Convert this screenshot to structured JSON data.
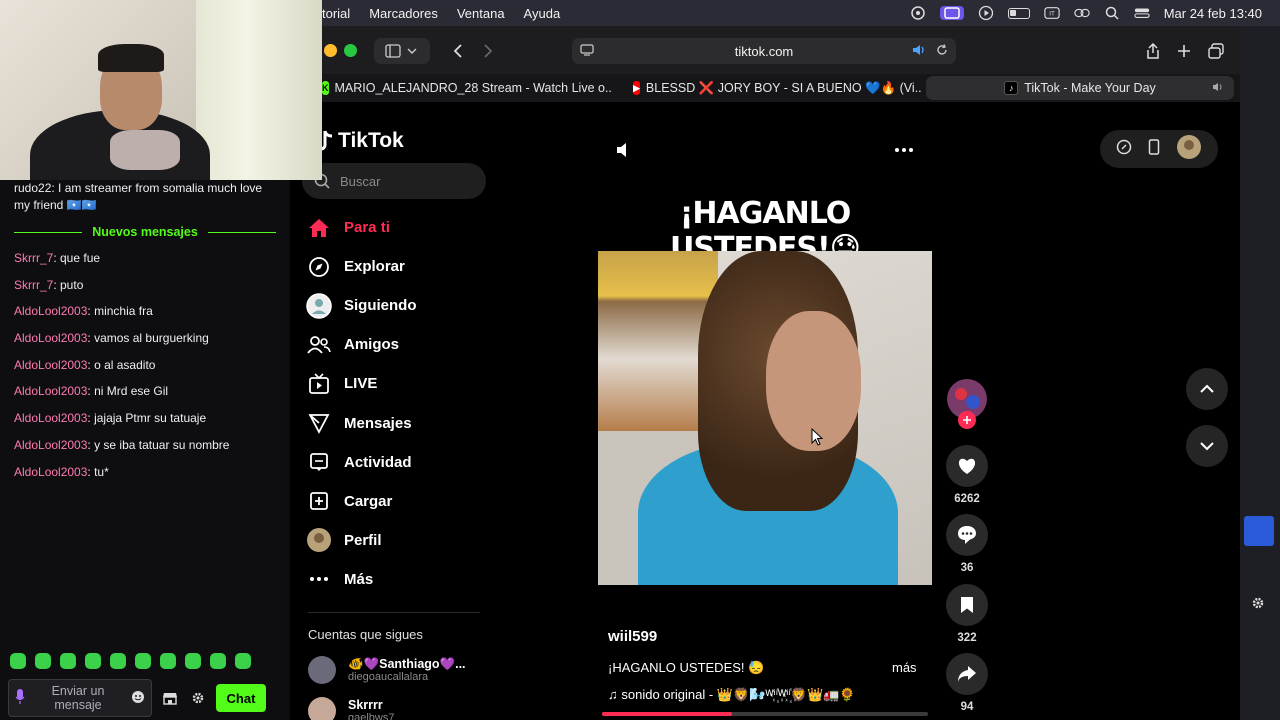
{
  "menubar": {
    "menus": [
      "torial",
      "Marcadores",
      "Ventana",
      "Ayuda"
    ],
    "datetime": "Mar 24 feb 13:40",
    "icons": [
      "copilot-icon",
      "screen-mirroring-icon",
      "play-icon",
      "battery-icon",
      "input-source-icon",
      "link-icon",
      "search-icon",
      "control-center-icon"
    ]
  },
  "chat": {
    "first_message": "rudo22: I am streamer from somalia much love my friend 🇸🇴🇸🇴",
    "new_messages_label": "Nuevos mensajes",
    "messages": [
      {
        "user": "Skrrr_7",
        "text": ": que fue"
      },
      {
        "user": "Skrrr_7",
        "text": ": puto"
      },
      {
        "user": "AldoLool2003",
        "text": ": minchia fra"
      },
      {
        "user": "AldoLool2003",
        "text": ": vamos al burguerking"
      },
      {
        "user": "AldoLool2003",
        "text": ": o al asadito"
      },
      {
        "user": "AldoLool2003",
        "text": ": ni Mrd ese Gil"
      },
      {
        "user": "AldoLool2003",
        "text": ": jajaja Ptmr su tatuaje"
      },
      {
        "user": "AldoLool2003",
        "text": ": y se iba tatuar su nombre"
      },
      {
        "user": "AldoLool2003",
        "text": ": tu*"
      }
    ],
    "input_placeholder": "Enviar un mensaje",
    "send_label": "Chat",
    "accent": "#53fc18",
    "username_color": "#ff7ab3"
  },
  "browser": {
    "url": "tiktok.com",
    "tabs": [
      {
        "title": "MARIO_ALEJANDRO_28 Stream - Watch Live o..."
      },
      {
        "title": "BLESSD ❌ JORY BOY - SI A BUENO 💙🔥 (Vi..."
      },
      {
        "title": "TikTok - Make Your Day"
      }
    ]
  },
  "tiktok": {
    "logo": "TikTok",
    "search_placeholder": "Buscar",
    "nav": [
      {
        "label": "Para ti",
        "icon": "home-icon",
        "active": true
      },
      {
        "label": "Explorar",
        "icon": "compass-icon"
      },
      {
        "label": "Siguiendo",
        "icon": "following-avatar-icon"
      },
      {
        "label": "Amigos",
        "icon": "friends-icon"
      },
      {
        "label": "LIVE",
        "icon": "live-tv-icon"
      },
      {
        "label": "Mensajes",
        "icon": "send-icon"
      },
      {
        "label": "Actividad",
        "icon": "activity-icon"
      },
      {
        "label": "Cargar",
        "icon": "upload-icon"
      },
      {
        "label": "Perfil",
        "icon": "profile-avatar-icon"
      },
      {
        "label": "Más",
        "icon": "more-dots-icon"
      }
    ],
    "following_header": "Cuentas que sigues",
    "following_accounts": [
      {
        "name": "🐠💜Santhiago💜...",
        "handle": "diegoaucallalara"
      },
      {
        "name": "Skrrrr",
        "handle": "gaelbws7"
      }
    ],
    "video": {
      "headline": "¡HAGANLO USTEDES!😓",
      "username": "wiil599",
      "caption": "¡HAGANLO USTEDES! 😓",
      "more_label": "más",
      "sound": "sonido original - 👑🦁🌬️ᵂⁱⁱ꙰ᵂⁱⁱ꙰🦁👑🚛🌻",
      "progress": 0.4
    },
    "actions": {
      "likes": "6262",
      "comments": "36",
      "saves": "322",
      "shares": "94"
    },
    "brand_color": "#fe2c55"
  }
}
